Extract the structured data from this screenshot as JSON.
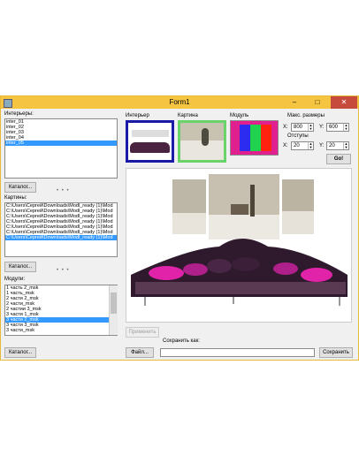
{
  "window": {
    "title": "Form1",
    "minimize": "–",
    "maximize": "□",
    "close": "✕"
  },
  "interiors": {
    "label": "Интерьеры:",
    "items": [
      "inter_01",
      "inter_02",
      "inter_03",
      "inter_04",
      "inter_05"
    ],
    "catalog": "Каталог..."
  },
  "pictures": {
    "label": "Картины:",
    "items": [
      "C:\\Users\\Сергей\\Downloads\\Modl_ready (1)\\Mod",
      "C:\\Users\\Сергей\\Downloads\\Modl_ready (1)\\Mod",
      "C:\\Users\\Сергей\\Downloads\\Modl_ready (1)\\Mod",
      "C:\\Users\\Сергей\\Downloads\\Modl_ready (1)\\Mod",
      "C:\\Users\\Сергей\\Downloads\\Modl_ready (1)\\Mod",
      "C:\\Users\\Сергей\\Downloads\\Modl_ready (1)\\Mod",
      "C:\\Users\\Сергей\\Downloads\\Modl_ready (1)\\Mod"
    ],
    "catalog": "Каталог..."
  },
  "modules": {
    "label": "Модули:",
    "items": [
      "1 часть 2_msk",
      "1 часть_msk",
      "2 части 2_msk",
      "2 части_msk",
      "2 частии 3_msk",
      "3 части 1_msk",
      "3 части 2_msk",
      "3 части 3_msk",
      "3 части_msk"
    ],
    "catalog": "Каталог..."
  },
  "tabs": {
    "interior": "Интерьер",
    "picture": "Картина",
    "module": "Модуль"
  },
  "sizes": {
    "label": "Макс. размеры",
    "x_label": "X:",
    "x": "800",
    "y_label": "Y:",
    "y": "600"
  },
  "offsets": {
    "label": "Отступы",
    "x_label": "X:",
    "x": "20",
    "y_label": "Y:",
    "y": "20"
  },
  "go": "Go!",
  "apply": "Применить",
  "save": {
    "label": "Сохранить как:",
    "file_button": "Файл...",
    "value": "",
    "save_button": "Сохранить"
  },
  "colors": {
    "selection": "#3399ff",
    "titlebar": "#f5c542",
    "close": "#c74b3d"
  }
}
